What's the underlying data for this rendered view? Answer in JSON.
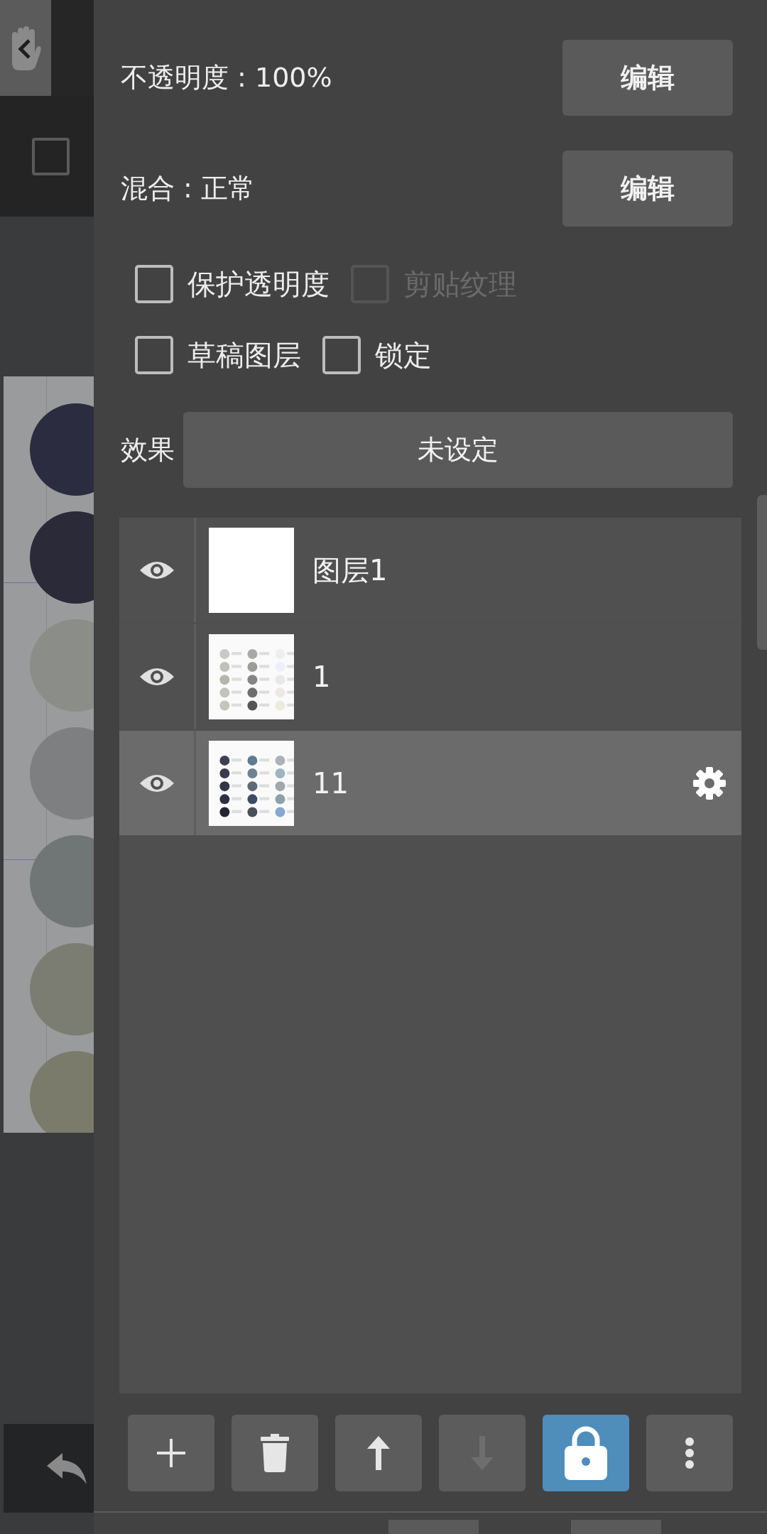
{
  "canvas_toolbar": {
    "checked": false
  },
  "properties": [
    {
      "label": "不透明度 : 100%",
      "button": "编辑"
    },
    {
      "label": "混合 : 正常",
      "button": "编辑"
    }
  ],
  "options": [
    [
      {
        "label": "保护透明度",
        "checked": false,
        "disabled": false
      },
      {
        "label": "剪贴纹理",
        "checked": false,
        "disabled": true
      }
    ],
    [
      {
        "label": "草稿图层",
        "checked": false,
        "disabled": false
      },
      {
        "label": "锁定",
        "checked": false,
        "disabled": false
      }
    ]
  ],
  "effect": {
    "label": "效果",
    "value": "未设定"
  },
  "layers": [
    {
      "name": "图层1",
      "visible": true,
      "selected": false,
      "kind": "blank"
    },
    {
      "name": "1",
      "visible": true,
      "selected": false,
      "kind": "picture"
    },
    {
      "name": "11",
      "visible": true,
      "selected": true,
      "kind": "picture"
    }
  ],
  "toolbar": [
    {
      "kind": "add",
      "disabled": false,
      "selected": false
    },
    {
      "kind": "delete",
      "disabled": false,
      "selected": false
    },
    {
      "kind": "up",
      "disabled": false,
      "selected": false
    },
    {
      "kind": "down",
      "disabled": true,
      "selected": false
    },
    {
      "kind": "lock",
      "disabled": false,
      "selected": true
    },
    {
      "kind": "more",
      "disabled": false,
      "selected": false
    }
  ]
}
